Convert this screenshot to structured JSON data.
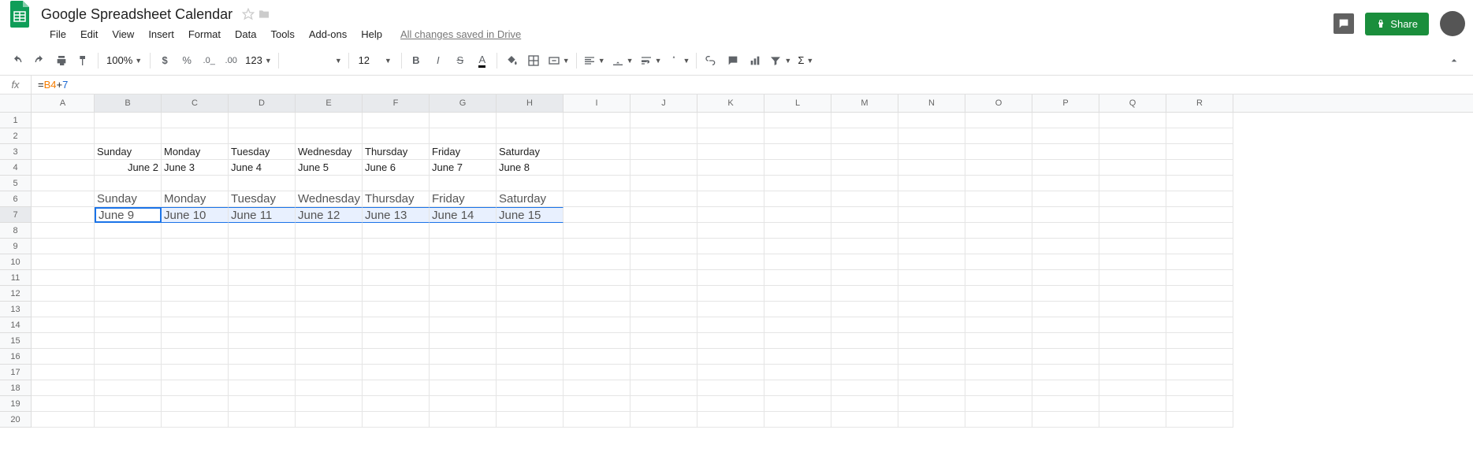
{
  "doc": {
    "title": "Google Spreadsheet Calendar"
  },
  "menu": {
    "file": "File",
    "edit": "Edit",
    "view": "View",
    "insert": "Insert",
    "format": "Format",
    "data": "Data",
    "tools": "Tools",
    "addons": "Add-ons",
    "help": "Help",
    "saved": "All changes saved in Drive"
  },
  "share": {
    "label": "Share"
  },
  "toolbar": {
    "zoom": "100%",
    "currency_auto": "123",
    "font_size": "12"
  },
  "formula": {
    "eq": "=",
    "ref": "B4",
    "op": "+",
    "num": "7"
  },
  "columns": [
    "A",
    "B",
    "C",
    "D",
    "E",
    "F",
    "G",
    "H",
    "I",
    "J",
    "K",
    "L",
    "M",
    "N",
    "O",
    "P",
    "Q",
    "R"
  ],
  "rows": [
    {
      "n": "1",
      "c": {}
    },
    {
      "n": "2",
      "c": {}
    },
    {
      "n": "3",
      "c": {
        "B": "Sunday",
        "C": "Monday",
        "D": "Tuesday",
        "E": "Wednesday",
        "F": "Thursday",
        "G": "Friday",
        "H": "Saturday"
      }
    },
    {
      "n": "4",
      "c": {
        "B": "June 2",
        "C": "June 3",
        "D": "June 4",
        "E": "June 5",
        "F": "June 6",
        "G": "June 7",
        "H": "June 8"
      }
    },
    {
      "n": "5",
      "c": {}
    },
    {
      "n": "6",
      "c": {
        "B": "Sunday",
        "C": "Monday",
        "D": "Tuesday",
        "E": "Wednesday",
        "F": "Thursday",
        "G": "Friday",
        "H": "Saturday"
      }
    },
    {
      "n": "7",
      "c": {
        "B": "June 9",
        "C": "June 10",
        "D": "June 11",
        "E": "June 12",
        "F": "June 13",
        "G": "June 14",
        "H": "June 15"
      }
    },
    {
      "n": "8",
      "c": {}
    },
    {
      "n": "9",
      "c": {}
    },
    {
      "n": "10",
      "c": {}
    },
    {
      "n": "11",
      "c": {}
    },
    {
      "n": "12",
      "c": {}
    },
    {
      "n": "13",
      "c": {}
    },
    {
      "n": "14",
      "c": {}
    },
    {
      "n": "15",
      "c": {}
    },
    {
      "n": "16",
      "c": {}
    },
    {
      "n": "17",
      "c": {}
    },
    {
      "n": "18",
      "c": {}
    },
    {
      "n": "19",
      "c": {}
    },
    {
      "n": "20",
      "c": {}
    }
  ],
  "selection": {
    "row": "7",
    "cols": [
      "B",
      "C",
      "D",
      "E",
      "F",
      "G",
      "H"
    ],
    "active": "B"
  },
  "bigRows": [
    "6",
    "7"
  ]
}
